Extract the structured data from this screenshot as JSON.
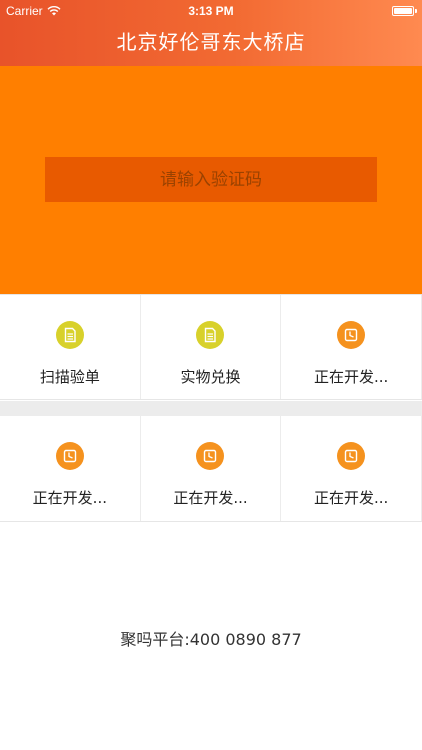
{
  "status_bar": {
    "carrier": "Carrier",
    "time": "3:13 PM"
  },
  "nav": {
    "title": "北京好伦哥东大桥店"
  },
  "code_input": {
    "placeholder": "请输入验证码",
    "value": ""
  },
  "grid": {
    "row1": [
      {
        "label": "扫描验单",
        "icon": "document-icon"
      },
      {
        "label": "实物兑换",
        "icon": "document-icon"
      },
      {
        "label": "正在开发...",
        "icon": "clock-icon"
      }
    ],
    "row2": [
      {
        "label": "正在开发...",
        "icon": "clock-icon"
      },
      {
        "label": "正在开发...",
        "icon": "clock-icon"
      },
      {
        "label": "正在开发...",
        "icon": "clock-icon"
      }
    ]
  },
  "footer": {
    "text": "聚吗平台:400 0890 877"
  },
  "colors": {
    "header_start": "#e8532a",
    "header_end": "#ff8a50",
    "code_bg": "#ff7f00",
    "input_bg": "#e85a00",
    "doc_icon": "#d8d12b",
    "clock_icon": "#f5921e"
  }
}
